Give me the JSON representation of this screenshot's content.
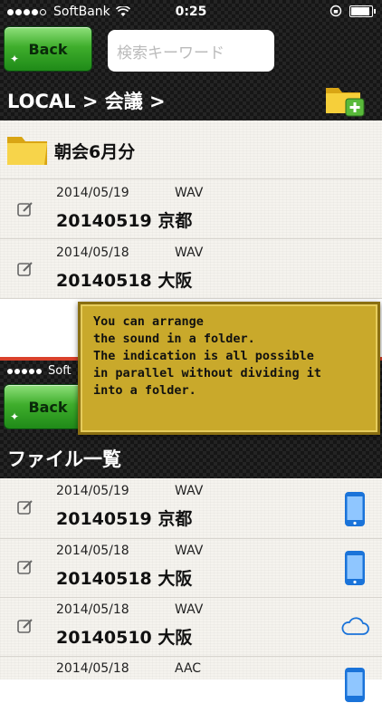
{
  "status_bar": {
    "carrier": "SoftBank",
    "time": "0:25"
  },
  "nav": {
    "back_label": "Back",
    "search_placeholder": "検索キーワード"
  },
  "breadcrumb": "LOCAL > 会議 >",
  "folder": {
    "name": "朝会6月分"
  },
  "folder_files": [
    {
      "date": "2014/05/19",
      "format": "WAV",
      "name": "20140519 京都"
    },
    {
      "date": "2014/05/18",
      "format": "WAV",
      "name": "20140518 大阪"
    }
  ],
  "second_screen": {
    "carrier": "Soft",
    "back_label": "Back",
    "title": "ファイル一覧",
    "files": [
      {
        "date": "2014/05/19",
        "format": "WAV",
        "name": "20140519 京都",
        "storage_icon": "phone-icon"
      },
      {
        "date": "2014/05/18",
        "format": "WAV",
        "name": "20140518 大阪",
        "storage_icon": "phone-icon"
      },
      {
        "date": "2014/05/18",
        "format": "WAV",
        "name": "20140510 大阪",
        "storage_icon": "cloud-icon"
      },
      {
        "date": "2014/05/18",
        "format": "AAC",
        "name": "",
        "storage_icon": "phone-icon"
      }
    ]
  },
  "tooltip": {
    "lines": [
      "You can arrange",
      "the sound in a folder.",
      "The indication is all possible",
      "in parallel without dividing it",
      "into a folder."
    ]
  },
  "colors": {
    "accent_green": "#3fae2c",
    "phone_blue": "#1a73d9",
    "tooltip_gold": "#c9a92b",
    "divider_red": "#d9412b"
  }
}
